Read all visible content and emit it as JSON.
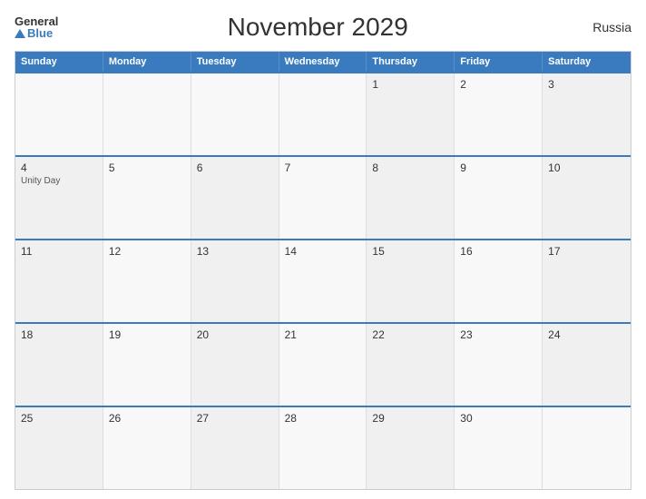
{
  "header": {
    "logo_general": "General",
    "logo_blue": "Blue",
    "title": "November 2029",
    "country": "Russia"
  },
  "calendar": {
    "weekdays": [
      "Sunday",
      "Monday",
      "Tuesday",
      "Wednesday",
      "Thursday",
      "Friday",
      "Saturday"
    ],
    "rows": [
      [
        {
          "day": "",
          "event": ""
        },
        {
          "day": "",
          "event": ""
        },
        {
          "day": "",
          "event": ""
        },
        {
          "day": "",
          "event": ""
        },
        {
          "day": "1",
          "event": ""
        },
        {
          "day": "2",
          "event": ""
        },
        {
          "day": "3",
          "event": ""
        }
      ],
      [
        {
          "day": "4",
          "event": "Unity Day"
        },
        {
          "day": "5",
          "event": ""
        },
        {
          "day": "6",
          "event": ""
        },
        {
          "day": "7",
          "event": ""
        },
        {
          "day": "8",
          "event": ""
        },
        {
          "day": "9",
          "event": ""
        },
        {
          "day": "10",
          "event": ""
        }
      ],
      [
        {
          "day": "11",
          "event": ""
        },
        {
          "day": "12",
          "event": ""
        },
        {
          "day": "13",
          "event": ""
        },
        {
          "day": "14",
          "event": ""
        },
        {
          "day": "15",
          "event": ""
        },
        {
          "day": "16",
          "event": ""
        },
        {
          "day": "17",
          "event": ""
        }
      ],
      [
        {
          "day": "18",
          "event": ""
        },
        {
          "day": "19",
          "event": ""
        },
        {
          "day": "20",
          "event": ""
        },
        {
          "day": "21",
          "event": ""
        },
        {
          "day": "22",
          "event": ""
        },
        {
          "day": "23",
          "event": ""
        },
        {
          "day": "24",
          "event": ""
        }
      ],
      [
        {
          "day": "25",
          "event": ""
        },
        {
          "day": "26",
          "event": ""
        },
        {
          "day": "27",
          "event": ""
        },
        {
          "day": "28",
          "event": ""
        },
        {
          "day": "29",
          "event": ""
        },
        {
          "day": "30",
          "event": ""
        },
        {
          "day": "",
          "event": ""
        }
      ]
    ]
  }
}
